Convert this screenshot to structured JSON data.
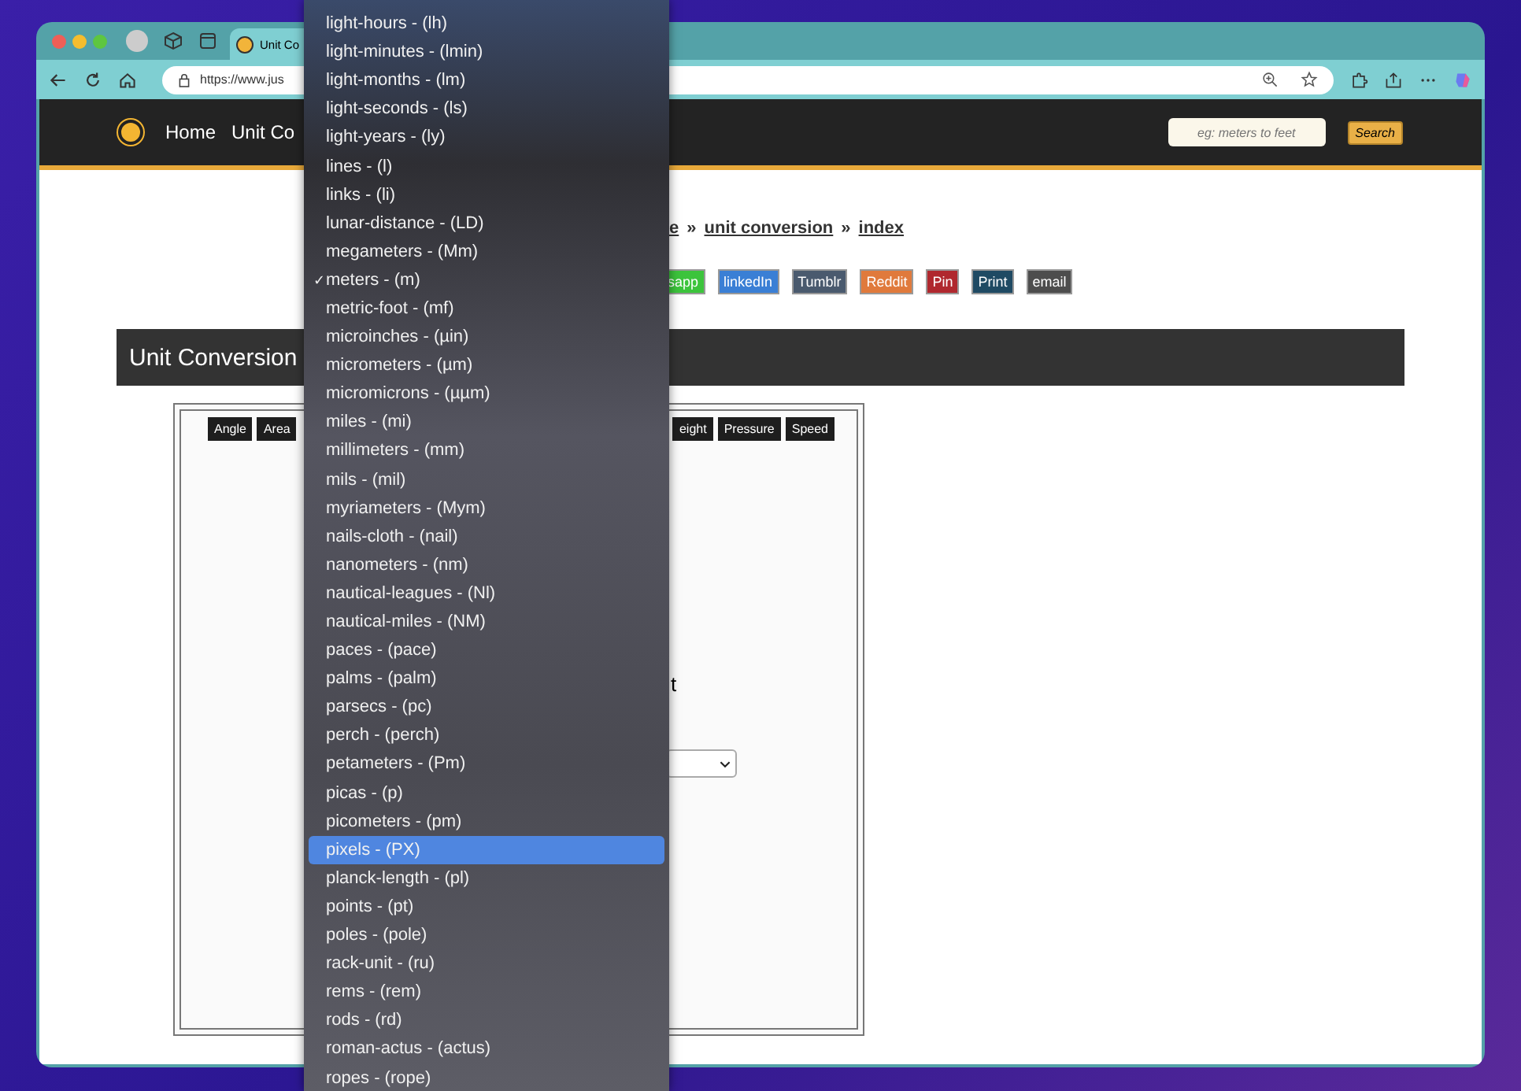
{
  "browser": {
    "tab_title": "Unit Co",
    "url": "https://www.jus"
  },
  "site_header": {
    "nav": [
      "Home",
      "Unit Co"
    ],
    "search": {
      "placeholder": "eg: meters to feet"
    },
    "search_button": "Search"
  },
  "breadcrumb": [
    "e",
    "unit conversion",
    "index"
  ],
  "separators": [
    "»",
    "»"
  ],
  "share_buttons": [
    {
      "label": "sapp",
      "color": "#3cc43c"
    },
    {
      "label": "linkedIn",
      "color": "#3a7fd5"
    },
    {
      "label": "Tumblr",
      "color": "#4a5a6e"
    },
    {
      "label": "Reddit",
      "color": "#e07a3c"
    },
    {
      "label": "Pin",
      "color": "#b0282e"
    },
    {
      "label": "Print",
      "color": "#1f4a63"
    },
    {
      "label": "email",
      "color": "#4d4d4d"
    }
  ],
  "heading": "Unit Conversion",
  "converter": {
    "tabs_left": [
      "Angle",
      "Area"
    ],
    "tabs_right": [
      "eight",
      "Pressure",
      "Speed"
    ],
    "partial_text": "t"
  },
  "dropdown": {
    "check_mark": "✓",
    "options": [
      {
        "label": "light-hours - (lh)",
        "checked": false,
        "selected": false
      },
      {
        "label": "light-minutes - (lmin)",
        "checked": false,
        "selected": false
      },
      {
        "label": "light-months - (lm)",
        "checked": false,
        "selected": false
      },
      {
        "label": "light-seconds - (ls)",
        "checked": false,
        "selected": false
      },
      {
        "label": "light-years - (ly)",
        "checked": false,
        "selected": false
      },
      {
        "label": "lines - (l)",
        "checked": false,
        "selected": false
      },
      {
        "label": "links - (li)",
        "checked": false,
        "selected": false
      },
      {
        "label": "lunar-distance - (LD)",
        "checked": false,
        "selected": false
      },
      {
        "label": "megameters - (Mm)",
        "checked": false,
        "selected": false
      },
      {
        "label": "meters - (m)",
        "checked": true,
        "selected": false
      },
      {
        "label": "metric-foot - (mf)",
        "checked": false,
        "selected": false
      },
      {
        "label": "microinches - (µin)",
        "checked": false,
        "selected": false
      },
      {
        "label": "micrometers - (µm)",
        "checked": false,
        "selected": false
      },
      {
        "label": "micromicrons - (µµm)",
        "checked": false,
        "selected": false
      },
      {
        "label": "miles - (mi)",
        "checked": false,
        "selected": false
      },
      {
        "label": "millimeters - (mm)",
        "checked": false,
        "selected": false
      },
      {
        "label": "mils - (mil)",
        "checked": false,
        "selected": false
      },
      {
        "label": "myriameters - (Mym)",
        "checked": false,
        "selected": false
      },
      {
        "label": "nails-cloth - (nail)",
        "checked": false,
        "selected": false
      },
      {
        "label": "nanometers - (nm)",
        "checked": false,
        "selected": false
      },
      {
        "label": "nautical-leagues - (Nl)",
        "checked": false,
        "selected": false
      },
      {
        "label": "nautical-miles - (NM)",
        "checked": false,
        "selected": false
      },
      {
        "label": "paces - (pace)",
        "checked": false,
        "selected": false
      },
      {
        "label": "palms - (palm)",
        "checked": false,
        "selected": false
      },
      {
        "label": "parsecs - (pc)",
        "checked": false,
        "selected": false
      },
      {
        "label": "perch - (perch)",
        "checked": false,
        "selected": false
      },
      {
        "label": "petameters - (Pm)",
        "checked": false,
        "selected": false
      },
      {
        "label": "picas - (p)",
        "checked": false,
        "selected": false
      },
      {
        "label": "picometers - (pm)",
        "checked": false,
        "selected": false
      },
      {
        "label": "pixels - (PX)",
        "checked": false,
        "selected": true
      },
      {
        "label": "planck-length - (pl)",
        "checked": false,
        "selected": false
      },
      {
        "label": "points - (pt)",
        "checked": false,
        "selected": false
      },
      {
        "label": "poles - (pole)",
        "checked": false,
        "selected": false
      },
      {
        "label": "rack-unit - (ru)",
        "checked": false,
        "selected": false
      },
      {
        "label": "rems - (rem)",
        "checked": false,
        "selected": false
      },
      {
        "label": "rods - (rd)",
        "checked": false,
        "selected": false
      },
      {
        "label": "roman-actus - (actus)",
        "checked": false,
        "selected": false
      },
      {
        "label": "ropes - (rope)",
        "checked": false,
        "selected": false
      }
    ]
  }
}
